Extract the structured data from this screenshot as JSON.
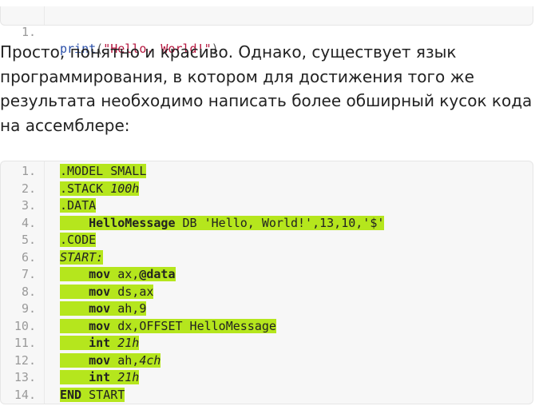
{
  "top_snippet": {
    "line_number": "1.",
    "fn": "print",
    "open_paren": "(",
    "string": "\"Hello, World!\"",
    "close_paren": ")"
  },
  "paragraph": "Просто, понятно и красиво. Однако, существует язык программирования, в котором для достижения того же результата необходимо написать более обширный кусок кода на ассемблере:",
  "asm_snippet": {
    "lines": [
      {
        "num": "1.",
        "indent": "",
        "parts": [
          {
            "t": ".MODEL SMALL"
          }
        ]
      },
      {
        "num": "2.",
        "indent": "",
        "parts": [
          {
            "t": ".STACK "
          },
          {
            "t": "100h",
            "s": "it"
          }
        ]
      },
      {
        "num": "3.",
        "indent": "",
        "parts": [
          {
            "t": ".DATA"
          }
        ]
      },
      {
        "num": "4.",
        "indent": "    ",
        "parts": [
          {
            "t": "HelloMessage",
            "s": "kw"
          },
          {
            "t": " DB 'Hello, World!',13,10,'$'"
          }
        ]
      },
      {
        "num": "5.",
        "indent": "",
        "parts": [
          {
            "t": ".CODE"
          }
        ]
      },
      {
        "num": "6.",
        "indent": "",
        "parts": [
          {
            "t": "START:",
            "s": "it"
          }
        ]
      },
      {
        "num": "7.",
        "indent": "    ",
        "parts": [
          {
            "t": "mov",
            "s": "kw"
          },
          {
            "t": " ax,"
          },
          {
            "t": "@data",
            "s": "kw"
          }
        ]
      },
      {
        "num": "8.",
        "indent": "    ",
        "parts": [
          {
            "t": "mov",
            "s": "kw"
          },
          {
            "t": " ds,ax"
          }
        ]
      },
      {
        "num": "9.",
        "indent": "    ",
        "parts": [
          {
            "t": "mov",
            "s": "kw"
          },
          {
            "t": " ah,9"
          }
        ]
      },
      {
        "num": "10.",
        "indent": "    ",
        "parts": [
          {
            "t": "mov",
            "s": "kw"
          },
          {
            "t": " dx,OFFSET HelloMessage"
          }
        ]
      },
      {
        "num": "11.",
        "indent": "    ",
        "parts": [
          {
            "t": "int",
            "s": "kw"
          },
          {
            "t": " "
          },
          {
            "t": "21h",
            "s": "it"
          }
        ]
      },
      {
        "num": "12.",
        "indent": "    ",
        "parts": [
          {
            "t": "mov",
            "s": "kw"
          },
          {
            "t": " ah,"
          },
          {
            "t": "4ch",
            "s": "it"
          }
        ]
      },
      {
        "num": "13.",
        "indent": "    ",
        "parts": [
          {
            "t": "int",
            "s": "kw"
          },
          {
            "t": " "
          },
          {
            "t": "21h",
            "s": "it"
          }
        ]
      },
      {
        "num": "14.",
        "indent": "",
        "parts": [
          {
            "t": "END",
            "s": "kw"
          },
          {
            "t": " START"
          }
        ]
      }
    ]
  },
  "colors": {
    "highlight": "#b5e61d",
    "code_background": "#f7f7f7",
    "python_function": "#2a4fa8",
    "python_string": "#b5173f"
  }
}
